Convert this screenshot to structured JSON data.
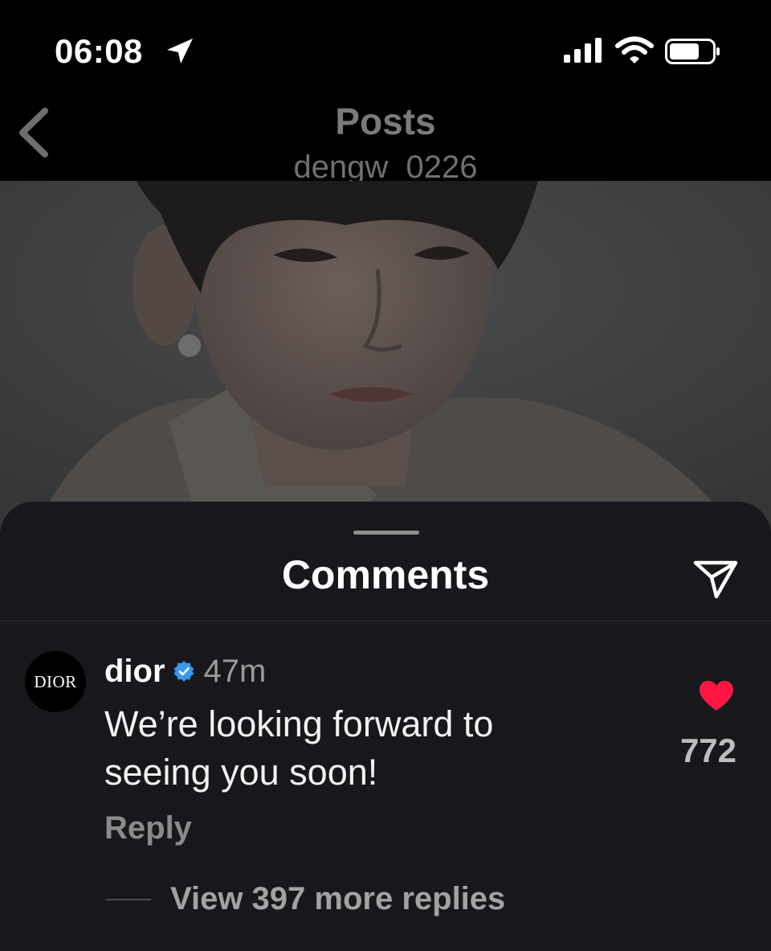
{
  "status_bar": {
    "time": "06:08",
    "icons": [
      "location-arrow-icon",
      "cellular-signal-icon",
      "wifi-icon",
      "battery-icon"
    ]
  },
  "header": {
    "title": "Posts",
    "subtitle": "dengw_0226",
    "back_icon": "chevron-left-icon"
  },
  "comments_sheet": {
    "title": "Comments",
    "share_icon": "paper-plane-icon",
    "comment": {
      "avatar_text": "DIOR",
      "username": "dior",
      "verified": true,
      "time": "47m",
      "text": "We’re looking forward to seeing you soon!",
      "reply_label": "Reply",
      "like_icon": "heart-icon",
      "like_count": "772",
      "view_replies_label": "View 397 more replies"
    }
  },
  "colors": {
    "background": "#000000",
    "sheet": "#16181b",
    "heart": "#ff1744",
    "verified": "#3897f0",
    "muted_text": "#8a8a8a"
  }
}
